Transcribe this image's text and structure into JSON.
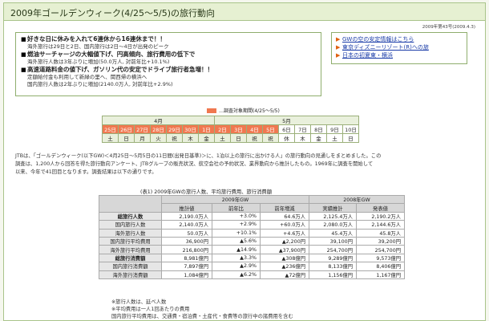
{
  "title": "2009年ゴールデンウィーク(4/25〜5/5)の旅行動向",
  "date_line": "2009年第43号(2009.4.3)",
  "highlights": [
    {
      "head": "好きな日に休みを入れて6連休から16連休まで！！",
      "subs": [
        "海外旅行は29日と2日、国内旅行は2日〜4日が出発のピーク"
      ]
    },
    {
      "head": "燃油サーチャージの大幅値下げ、円高傾向、旅行費用の低下で",
      "subs": [
        "海外旅行人数は3年ぶりに増加(50.0万人, 対前年比+10.1%)"
      ]
    },
    {
      "head": "高速道路料金の値下げ、ガソリン代の安定でドライブ旅行者急増！！",
      "subs": [
        "定額給付金も利用して新緑の里へ、関西帰の横浜へ",
        "国内旅行人数は2年ぶりに増加(2140.0万人, 対前年比+2.9%)"
      ]
    }
  ],
  "links": [
    "GWの空の安定情報はこちら",
    "東京ディズニーリゾート(R)への旅",
    "日本の初夏東・横浜"
  ],
  "calendar": {
    "legend": "…調査対象期間(4/25〜5/5)",
    "months": {
      "april": "4月",
      "may": "5月"
    },
    "dates": [
      "25日",
      "26日",
      "27日",
      "28日",
      "29日",
      "30日",
      "1日",
      "2日",
      "3日",
      "4日",
      "5日",
      "6日",
      "7日",
      "8日",
      "9日",
      "10日"
    ],
    "weekdays": [
      "土",
      "日",
      "月",
      "火",
      "祝",
      "木",
      "金",
      "土",
      "日",
      "祝",
      "祝",
      "休",
      "木",
      "金",
      "土",
      "日"
    ],
    "highlighted_count": 11
  },
  "intro": [
    "JTBは、「ゴールデンウィーク(以下GW)＜4月25日〜5月5日の11日間(出発日基準)＞に、1泊以上の旅行に出かける人」の旅行動向の見通しをまとめました。この",
    "調査は、1,200人から回答を得た旅行動向アンケート、JTBグループの販売状況、航空会社の予約状況、業界動向から推計したもの。1969年に調査を開始して",
    "以来、今年で41回目となります。調査結果は以下の通りです。"
  ],
  "table": {
    "caption": "(表1) 2009年GWの旅行人数、平均旅行費用、旅行消費額",
    "group_2009": "2009年GW",
    "group_2008": "2008年GW",
    "col_headers": [
      "推計値",
      "前年比",
      "前年増減",
      "実績推計",
      "発表値"
    ],
    "rows": [
      {
        "label": "総旅行人数",
        "bold": true,
        "cells": [
          "2,190.0万人",
          "+3.0%",
          "64.6万人",
          "2,125.4万人",
          "2,190.2万人"
        ]
      },
      {
        "label": "国内旅行人数",
        "bold": false,
        "cells": [
          "2,140.0万人",
          "+2.9%",
          "+60.0万人",
          "2,080.0万人",
          "2,144.6万人"
        ]
      },
      {
        "label": "海外旅行人数",
        "bold": false,
        "cells": [
          "50.0万人",
          "+10.1%",
          "+4.6万人",
          "45.4万人",
          "45.8万人"
        ]
      },
      {
        "label": "国内旅行平均費用",
        "bold": false,
        "cells": [
          "36,900円",
          "▲5.6%",
          "▲2,200円",
          "39,100円",
          "39,200円"
        ]
      },
      {
        "label": "海外旅行平均費用",
        "bold": false,
        "cells": [
          "216,800円",
          "▲14.9%",
          "▲37,900円",
          "254,700円",
          "254,700円"
        ]
      },
      {
        "label": "総旅行消費額",
        "bold": true,
        "cells": [
          "8,981億円",
          "▲3.3%",
          "▲308億円",
          "9,289億円",
          "9,573億円"
        ]
      },
      {
        "label": "国内旅行消費額",
        "bold": false,
        "cells": [
          "7,897億円",
          "▲2.9%",
          "▲236億円",
          "8,133億円",
          "8,406億円"
        ]
      },
      {
        "label": "海外旅行消費額",
        "bold": false,
        "cells": [
          "1,084億円",
          "▲6.2%",
          "▲72億円",
          "1,156億円",
          "1,167億円"
        ]
      }
    ]
  },
  "notes": [
    "※旅行人数は、延べ人数",
    "※平均費用は一人1回あたりの費用",
    "国内旅行平均費用は、交通費・宿泊費・土産代・食費等の旅行中の諸費用を含む"
  ],
  "colors": {
    "accent": "#f07850",
    "frame": "#a9c48a",
    "link": "#1a3ca8"
  }
}
